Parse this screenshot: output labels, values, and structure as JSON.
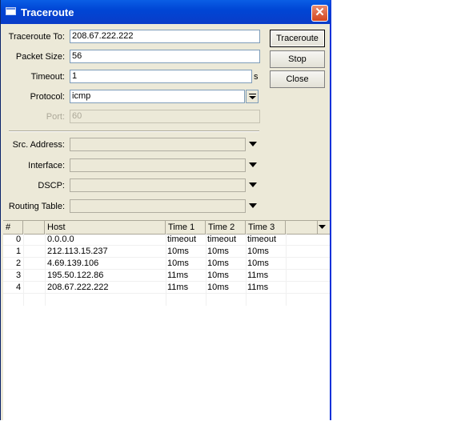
{
  "window": {
    "title": "Traceroute",
    "icon": "window-icon",
    "close": "✕"
  },
  "form": {
    "traceroute_to_label": "Traceroute To:",
    "traceroute_to_value": "208.67.222.222",
    "packet_size_label": "Packet Size:",
    "packet_size_value": "56",
    "timeout_label": "Timeout:",
    "timeout_value": "1",
    "timeout_unit": "s",
    "protocol_label": "Protocol:",
    "protocol_value": "icmp",
    "port_label": "Port:",
    "port_value": "60",
    "src_address_label": "Src. Address:",
    "interface_label": "Interface:",
    "dscp_label": "DSCP:",
    "routing_table_label": "Routing Table:"
  },
  "buttons": {
    "traceroute": "Traceroute",
    "stop": "Stop",
    "close": "Close"
  },
  "table": {
    "columns": [
      "#",
      "",
      "Host",
      "Time 1",
      "Time 2",
      "Time 3"
    ],
    "rows": [
      {
        "num": "0",
        "host": "0.0.0.0",
        "t1": "timeout",
        "t2": "timeout",
        "t3": "timeout"
      },
      {
        "num": "1",
        "host": "212.113.15.237",
        "t1": "10ms",
        "t2": "10ms",
        "t3": "10ms"
      },
      {
        "num": "2",
        "host": "4.69.139.106",
        "t1": "10ms",
        "t2": "10ms",
        "t3": "10ms"
      },
      {
        "num": "3",
        "host": "195.50.122.86",
        "t1": "11ms",
        "t2": "10ms",
        "t3": "11ms"
      },
      {
        "num": "4",
        "host": "208.67.222.222",
        "t1": "11ms",
        "t2": "10ms",
        "t3": "11ms"
      }
    ]
  }
}
